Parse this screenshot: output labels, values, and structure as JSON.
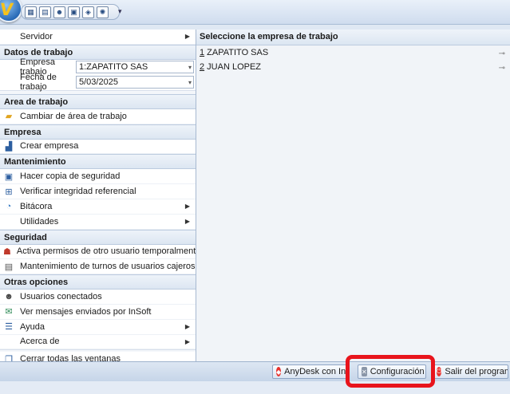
{
  "menu": {
    "server_label": "Servidor",
    "datos_header": "Datos de trabajo",
    "empresa_label": "Empresa trabajo",
    "empresa_value": "1:ZAPATITO SAS",
    "fecha_label": "Fecha de trabajo",
    "fecha_value": "5/03/2025",
    "area_header": "Area de trabajo",
    "cambiar_area": "Cambiar de área de trabajo",
    "empresa_header": "Empresa",
    "crear_empresa": "Crear empresa",
    "mant_header": "Mantenimiento",
    "copia": "Hacer copia de seguridad",
    "integridad": "Verificar integridad referencial",
    "bitacora": "Bitácora",
    "utilidades": "Utilidades",
    "seg_header": "Seguridad",
    "permisos": "Activa permisos de otro usuario temporalmente",
    "turnos": "Mantenimiento de turnos de usuarios cajeros",
    "otras_header": "Otras opciones",
    "usuarios": "Usuarios conectados",
    "mensajes": "Ver mensajes enviados por InSoft",
    "ayuda": "Ayuda",
    "acerca": "Acerca de",
    "cerrar": "Cerrar todas las ventanas"
  },
  "right": {
    "header": "Seleccione la empresa de trabajo",
    "companies": [
      {
        "num": "1",
        "name": " ZAPATITO SAS"
      },
      {
        "num": "2",
        "name": " JUAN LOPEZ"
      }
    ]
  },
  "status": {
    "anydesk": "AnyDesk con InSoft",
    "config": "Configuración",
    "salir": "Salir del programa"
  },
  "colors": {
    "highlight": "#e8141c",
    "accent": "#2a6bb8"
  }
}
